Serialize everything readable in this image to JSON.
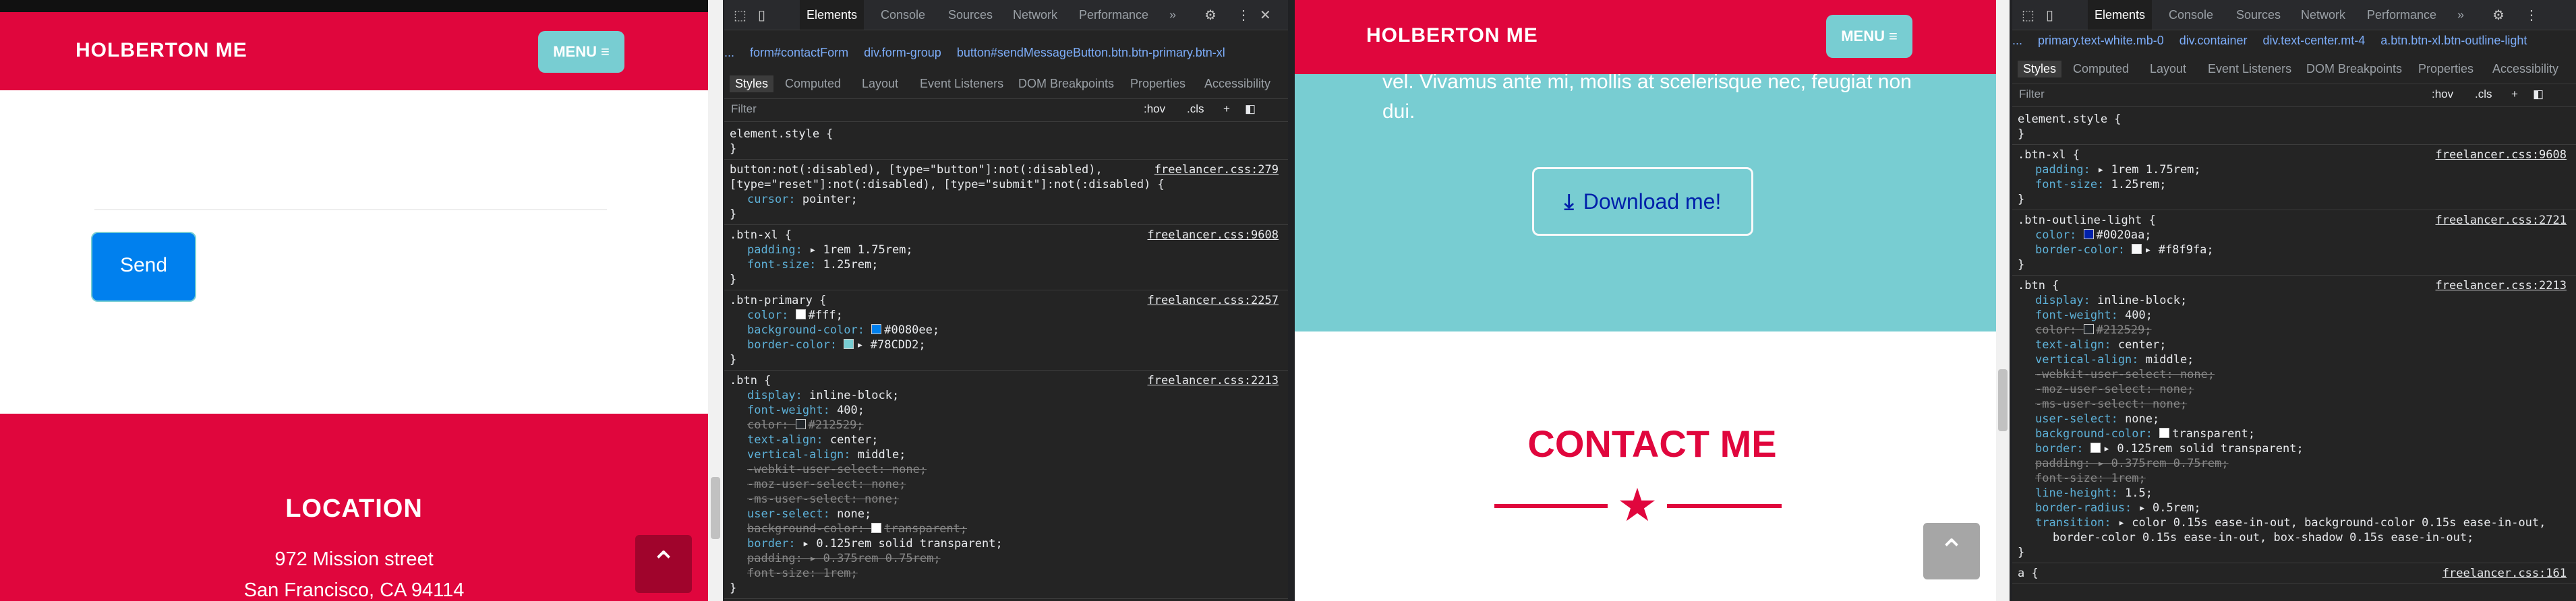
{
  "left_page": {
    "brand": "HOLBERTON ME",
    "menu_label": "MENU",
    "send_label": "Send",
    "location": {
      "title": "LOCATION",
      "line1": "972 Mission street",
      "line2": "San Francisco, CA 94114"
    },
    "scroll_top_icon": "chevron-up-icon"
  },
  "left_devtools": {
    "tabs": [
      "Elements",
      "Console",
      "Sources",
      "Network",
      "Performance"
    ],
    "active_tab": "Elements",
    "more": "»",
    "breadcrumbs": [
      "...",
      "form#contactForm",
      "div.form-group",
      "button#sendMessageButton.btn.btn-primary.btn-xl"
    ],
    "subtabs": [
      "Styles",
      "Computed",
      "Layout",
      "Event Listeners",
      "DOM Breakpoints",
      "Properties",
      "Accessibility"
    ],
    "filter_placeholder": "Filter",
    "hov": ":hov",
    "cls": ".cls",
    "rules": [
      {
        "selector": "element.style {",
        "source": "",
        "decls": []
      },
      {
        "selector": "button:not(:disabled), [type=\"button\"]:not(:disabled),\n[type=\"reset\"]:not(:disabled), [type=\"submit\"]:not(:disabled) {",
        "source": "freelancer.css:279",
        "decls": [
          {
            "p": "cursor",
            "v": "pointer;"
          }
        ]
      },
      {
        "selector": ".btn-xl {",
        "source": "freelancer.css:9608",
        "decls": [
          {
            "p": "padding",
            "v": "▸ 1rem 1.75rem;"
          },
          {
            "p": "font-size",
            "v": "1.25rem;"
          }
        ]
      },
      {
        "selector": ".btn-primary {",
        "source": "freelancer.css:2257",
        "decls": [
          {
            "p": "color",
            "v": "#fff;",
            "sw": "#ffffff"
          },
          {
            "p": "background-color",
            "v": "#0080ee;",
            "sw": "#0080ee"
          },
          {
            "p": "border-color",
            "v": "▸ #78CDD2;",
            "sw": "#78cdd2"
          }
        ]
      },
      {
        "selector": ".btn {",
        "source": "freelancer.css:2213",
        "decls": [
          {
            "p": "display",
            "v": "inline-block;"
          },
          {
            "p": "font-weight",
            "v": "400;"
          },
          {
            "p": "color",
            "v": "#212529;",
            "sw": "#212529",
            "s": true
          },
          {
            "p": "text-align",
            "v": "center;"
          },
          {
            "p": "vertical-align",
            "v": "middle;"
          },
          {
            "p": "-webkit-user-select",
            "v": "none;",
            "s": true
          },
          {
            "p": "-moz-user-select",
            "v": "none;",
            "s": true
          },
          {
            "p": "-ms-user-select",
            "v": "none;",
            "s": true
          },
          {
            "p": "user-select",
            "v": "none;"
          },
          {
            "p": "background-color",
            "v": "transparent;",
            "sw": "#ffffff",
            "s": true
          },
          {
            "p": "border",
            "v": "▸ 0.125rem solid transparent;"
          },
          {
            "p": "padding",
            "v": "▸ 0.375rem 0.75rem;",
            "s": true
          },
          {
            "p": "font-size",
            "v": "1rem;",
            "s": true
          }
        ]
      }
    ]
  },
  "right_page": {
    "brand": "HOLBERTON ME",
    "menu_label": "MENU",
    "about_line1": "vel. Vivamus ante mi, mollis at scelerisque nec, feugiat non",
    "about_line2": "dui.",
    "download_label": "Download me!",
    "contact_title": "CONTACT ME",
    "scroll_top_icon": "chevron-up-icon"
  },
  "right_devtools": {
    "tabs": [
      "Elements",
      "Console",
      "Sources",
      "Network",
      "Performance"
    ],
    "active_tab": "Elements",
    "more": "»",
    "breadcrumbs": [
      "...",
      "primary.text-white.mb-0",
      "div.container",
      "div.text-center.mt-4",
      "a.btn.btn-xl.btn-outline-light"
    ],
    "subtabs": [
      "Styles",
      "Computed",
      "Layout",
      "Event Listeners",
      "DOM Breakpoints",
      "Properties",
      "Accessibility"
    ],
    "filter_placeholder": "Filter",
    "hov": ":hov",
    "cls": ".cls",
    "rules": [
      {
        "selector": "element.style {",
        "source": "",
        "decls": []
      },
      {
        "selector": ".btn-xl {",
        "source": "freelancer.css:9608",
        "decls": [
          {
            "p": "padding",
            "v": "▸ 1rem 1.75rem;"
          },
          {
            "p": "font-size",
            "v": "1.25rem;"
          }
        ]
      },
      {
        "selector": ".btn-outline-light {",
        "source": "freelancer.css:2721",
        "decls": [
          {
            "p": "color",
            "v": "#0020aa;",
            "sw": "#0020aa"
          },
          {
            "p": "border-color",
            "v": "▸ #f8f9fa;",
            "sw": "#f8f9fa"
          }
        ]
      },
      {
        "selector": ".btn {",
        "source": "freelancer.css:2213",
        "decls": [
          {
            "p": "display",
            "v": "inline-block;"
          },
          {
            "p": "font-weight",
            "v": "400;"
          },
          {
            "p": "color",
            "v": "#212529;",
            "sw": "#212529",
            "s": true
          },
          {
            "p": "text-align",
            "v": "center;"
          },
          {
            "p": "vertical-align",
            "v": "middle;"
          },
          {
            "p": "-webkit-user-select",
            "v": "none;",
            "s": true
          },
          {
            "p": "-moz-user-select",
            "v": "none;",
            "s": true
          },
          {
            "p": "-ms-user-select",
            "v": "none;",
            "s": true
          },
          {
            "p": "user-select",
            "v": "none;"
          },
          {
            "p": "background-color",
            "v": "transparent;",
            "sw": "#ffffff"
          },
          {
            "p": "border",
            "v": "▸ 0.125rem solid transparent;",
            "sw": "#ffffff"
          },
          {
            "p": "padding",
            "v": "▸ 0.375rem 0.75rem;",
            "s": true
          },
          {
            "p": "font-size",
            "v": "1rem;",
            "s": true
          },
          {
            "p": "line-height",
            "v": "1.5;"
          },
          {
            "p": "border-radius",
            "v": "▸ 0.5rem;"
          },
          {
            "p": "transition",
            "v": "▸ color 0.15s ease-in-out, background-color 0.15s ease-in-out,"
          },
          {
            "p": "",
            "v": "border-color 0.15s ease-in-out, box-shadow 0.15s ease-in-out;"
          }
        ]
      },
      {
        "selector": "a {",
        "source": "freelancer.css:161",
        "decls": []
      }
    ]
  },
  "colors": {
    "brand_red": "#e0063d",
    "teal": "#78cdd2",
    "primary_blue": "#0080ee",
    "dark_red": "#a0042c"
  }
}
